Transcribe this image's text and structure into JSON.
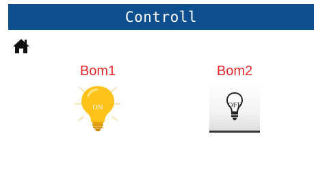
{
  "header": {
    "title": "Controll",
    "background_color": "#0d4e8f",
    "text_color": "#ffffff"
  },
  "home": {
    "icon": "home-icon"
  },
  "devices": [
    {
      "label": "Bom1",
      "state": "ON",
      "icon": "bulb-on-icon",
      "label_color": "#e8252b",
      "bulb_color": "#ffc21a"
    },
    {
      "label": "Bom2",
      "state": "OFF",
      "icon": "bulb-off-icon",
      "label_color": "#e8252b"
    }
  ]
}
